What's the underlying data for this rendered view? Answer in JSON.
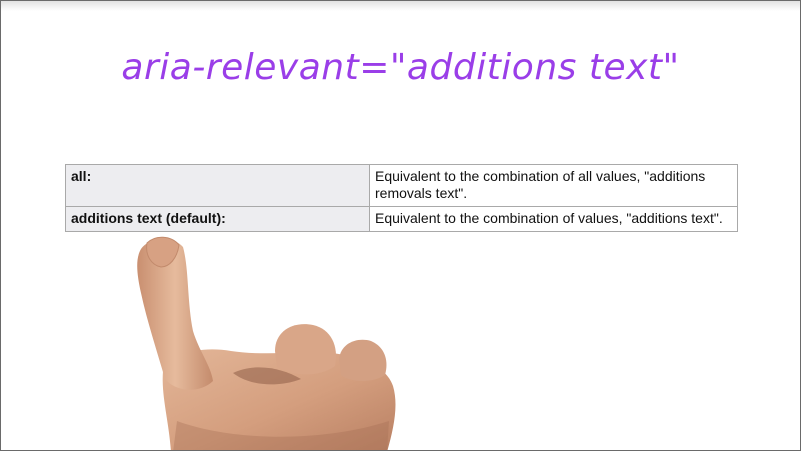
{
  "title": "aria-relevant=\"additions text\"",
  "table": {
    "rows": [
      {
        "term": "all:",
        "description": "Equivalent to the combination of all values, \"additions removals text\"."
      },
      {
        "term": "additions text (default):",
        "description": "Equivalent to the combination of values, \"additions text\"."
      }
    ]
  },
  "overlay": {
    "image": "pointing-hand"
  },
  "colors": {
    "title": "#9a3ee8",
    "term_cell_bg": "#ededf0",
    "border": "#a9a9a9",
    "skin": "#d9a888"
  }
}
